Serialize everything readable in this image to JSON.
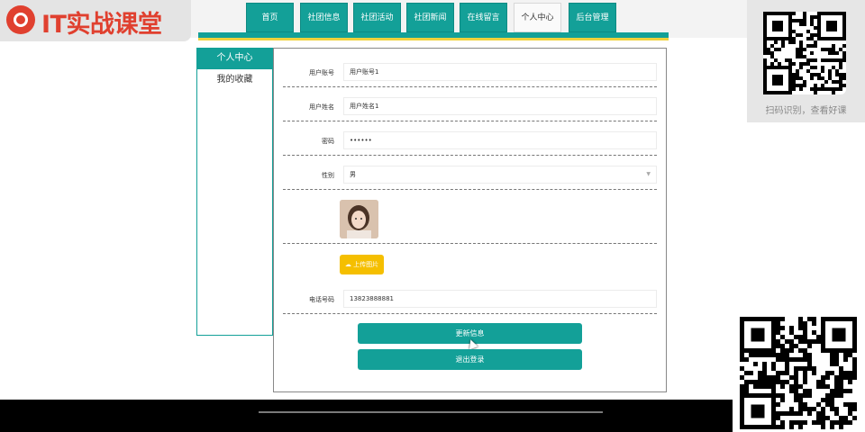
{
  "logo": {
    "text": "IT实战课堂"
  },
  "nav": [
    {
      "label": "首页",
      "active": false
    },
    {
      "label": "社团信息",
      "active": false
    },
    {
      "label": "社团活动",
      "active": false
    },
    {
      "label": "社团新闻",
      "active": false
    },
    {
      "label": "在线留言",
      "active": false
    },
    {
      "label": "个人中心",
      "active": true
    },
    {
      "label": "后台管理",
      "active": false
    }
  ],
  "sidebar": {
    "items": [
      {
        "label": "个人中心",
        "active": true
      },
      {
        "label": "我的收藏",
        "active": false
      }
    ]
  },
  "form": {
    "account": {
      "label": "用户账号",
      "value": "用户账号1"
    },
    "name": {
      "label": "用户姓名",
      "value": "用户姓名1"
    },
    "password": {
      "label": "密码",
      "value": "••••••"
    },
    "gender": {
      "label": "性别",
      "value": "男"
    },
    "upload_label": "上传图片",
    "phone": {
      "label": "电话号码",
      "value": "13823888881"
    }
  },
  "buttons": {
    "update": "更新信息",
    "logout": "退出登录"
  },
  "qr_card": {
    "caption": "扫码识别，查看好课"
  },
  "colors": {
    "primary": "#13a098",
    "accent": "#f5bf00",
    "brand": "#e0402f"
  },
  "icons": {
    "upload": "cloud-upload-icon",
    "select": "chevron-down-icon"
  }
}
